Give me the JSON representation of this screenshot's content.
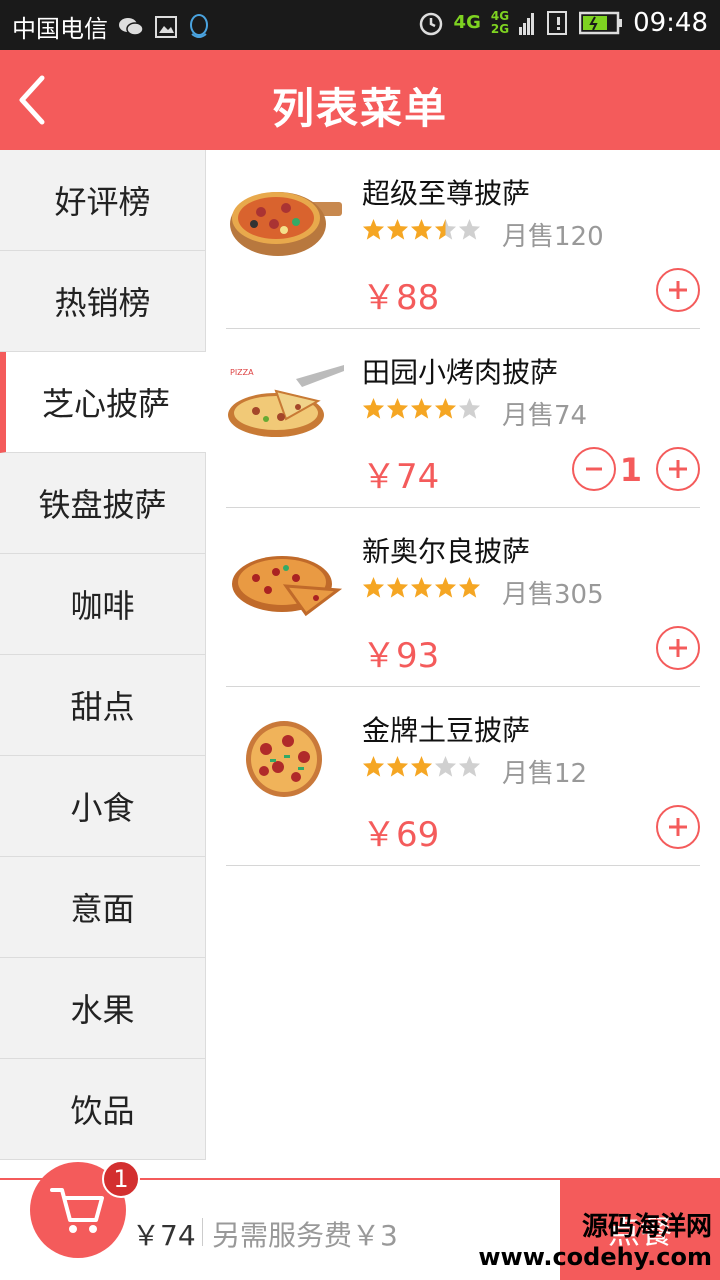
{
  "statusbar": {
    "carrier": "中国电信",
    "net_4g": "4G",
    "net_4g_small": "4G",
    "net_2g_small": "2G",
    "time": "09:48",
    "icons": [
      "wechat-icon",
      "image-icon",
      "qq-icon",
      "alarm-icon",
      "signal-icon",
      "sim-icon",
      "battery-icon"
    ]
  },
  "header": {
    "title": "列表菜单",
    "back_icon": "chevron-left-icon"
  },
  "sidebar": {
    "items": [
      {
        "label": "好评榜"
      },
      {
        "label": "热销榜"
      },
      {
        "label": "芝心披萨"
      },
      {
        "label": "铁盘披萨"
      },
      {
        "label": "咖啡"
      },
      {
        "label": "甜点"
      },
      {
        "label": "小食"
      },
      {
        "label": "意面"
      },
      {
        "label": "水果"
      },
      {
        "label": "饮品"
      }
    ],
    "active_index": 2
  },
  "products": [
    {
      "name": "超级至尊披萨",
      "rating": 3.5,
      "sold": "月售120",
      "price": "￥88",
      "quantity": 0
    },
    {
      "name": "田园小烤肉披萨",
      "rating": 4,
      "sold": "月售74",
      "price": "￥74",
      "quantity": 1,
      "quantity_text": "1"
    },
    {
      "name": "新奥尔良披萨",
      "rating": 5,
      "sold": "月售305",
      "price": "￥93",
      "quantity": 0
    },
    {
      "name": "金牌土豆披萨",
      "rating": 3,
      "sold": "月售12",
      "price": "￥69",
      "quantity": 0
    }
  ],
  "cart": {
    "badge": "1",
    "total": "￥74",
    "service_fee": "另需服务费￥3",
    "checkout_label": "点餐",
    "icon": "cart-icon"
  },
  "watermark": {
    "line1": "源码海洋网",
    "line2": "www.codehy.com"
  },
  "colors": {
    "accent": "#f45b5b",
    "star": "#f5a623",
    "star_empty": "#d0d0d0"
  }
}
